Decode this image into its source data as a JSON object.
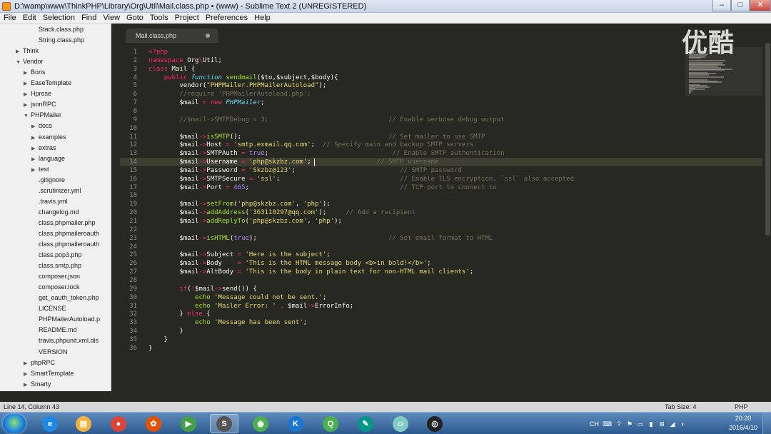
{
  "window": {
    "title": "D:\\wamp\\www\\ThinkPHP\\Library\\Org\\Util\\Mail.class.php • (www) - Sublime Text 2 (UNREGISTERED)",
    "minimize": "–",
    "maximize": "□",
    "close": "✕"
  },
  "menu": [
    "File",
    "Edit",
    "Selection",
    "Find",
    "View",
    "Goto",
    "Tools",
    "Project",
    "Preferences",
    "Help"
  ],
  "sidebar": {
    "items": [
      {
        "label": "Stack.class.php",
        "indent": 3,
        "type": "file"
      },
      {
        "label": "String.class.php",
        "indent": 3,
        "type": "file"
      },
      {
        "label": "Think",
        "indent": 1,
        "type": "folder"
      },
      {
        "label": "Vendor",
        "indent": 1,
        "type": "folder-open"
      },
      {
        "label": "Boris",
        "indent": 2,
        "type": "folder"
      },
      {
        "label": "EaseTemplate",
        "indent": 2,
        "type": "folder"
      },
      {
        "label": "Hprose",
        "indent": 2,
        "type": "folder"
      },
      {
        "label": "jsonRPC",
        "indent": 2,
        "type": "folder"
      },
      {
        "label": "PHPMailer",
        "indent": 2,
        "type": "folder-open"
      },
      {
        "label": "docs",
        "indent": 3,
        "type": "folder"
      },
      {
        "label": "examples",
        "indent": 3,
        "type": "folder"
      },
      {
        "label": "extras",
        "indent": 3,
        "type": "folder"
      },
      {
        "label": "language",
        "indent": 3,
        "type": "folder"
      },
      {
        "label": "test",
        "indent": 3,
        "type": "folder"
      },
      {
        "label": ".gitignore",
        "indent": 3,
        "type": "file"
      },
      {
        "label": ".scrutinizer.yml",
        "indent": 3,
        "type": "file"
      },
      {
        "label": ".travis.yml",
        "indent": 3,
        "type": "file"
      },
      {
        "label": "changelog.md",
        "indent": 3,
        "type": "file"
      },
      {
        "label": "class.phpmailer.php",
        "indent": 3,
        "type": "file"
      },
      {
        "label": "class.phpmaileroauth",
        "indent": 3,
        "type": "file"
      },
      {
        "label": "class.phpmaileroauth",
        "indent": 3,
        "type": "file"
      },
      {
        "label": "class.pop3.php",
        "indent": 3,
        "type": "file"
      },
      {
        "label": "class.smtp.php",
        "indent": 3,
        "type": "file"
      },
      {
        "label": "composer.json",
        "indent": 3,
        "type": "file"
      },
      {
        "label": "composer.lock",
        "indent": 3,
        "type": "file"
      },
      {
        "label": "get_oauth_token.php",
        "indent": 3,
        "type": "file"
      },
      {
        "label": "LICENSE",
        "indent": 3,
        "type": "file"
      },
      {
        "label": "PHPMailerAutoload.p",
        "indent": 3,
        "type": "file"
      },
      {
        "label": "README.md",
        "indent": 3,
        "type": "file"
      },
      {
        "label": "travis.phpunit.xml.dis",
        "indent": 3,
        "type": "file"
      },
      {
        "label": "VERSION",
        "indent": 3,
        "type": "file"
      },
      {
        "label": "phpRPC",
        "indent": 2,
        "type": "folder"
      },
      {
        "label": "SmartTemplate",
        "indent": 2,
        "type": "folder"
      },
      {
        "label": "Smarty",
        "indent": 2,
        "type": "folder"
      }
    ]
  },
  "tab": {
    "label": "Mail.class.php"
  },
  "code": [
    [
      [
        "k",
        "<?php"
      ]
    ],
    [
      [
        "k",
        "namespace "
      ],
      [
        "v",
        "Org"
      ],
      [
        "k",
        "\\"
      ],
      [
        "v",
        "Util;"
      ]
    ],
    [
      [
        "k",
        "class "
      ],
      [
        "v",
        "Mail {"
      ]
    ],
    [
      [
        "v",
        "    "
      ],
      [
        "k",
        "public "
      ],
      [
        "t",
        "function "
      ],
      [
        "f",
        "sendmail"
      ],
      [
        "v",
        "($to,$subject,$body){"
      ]
    ],
    [
      [
        "v",
        "        vendor("
      ],
      [
        "s",
        "\"PHPMailer.PHPMailerAutoload\""
      ],
      [
        "v",
        ");"
      ]
    ],
    [
      [
        "c",
        "        //require 'PHPMailerAutoload.php';"
      ]
    ],
    [
      [
        "v",
        "        $mail "
      ],
      [
        "k",
        "= new "
      ],
      [
        "cls",
        "PHPMailer"
      ],
      [
        "v",
        ";"
      ]
    ],
    [],
    [
      [
        "c",
        "        //$mail->SMTPDebug = 3;                               // Enable verbose debug output"
      ]
    ],
    [],
    [
      [
        "v",
        "        $mail"
      ],
      [
        "k",
        "->"
      ],
      [
        "f",
        "isSMTP"
      ],
      [
        "v",
        "();                                      "
      ],
      [
        "c",
        "// Set mailer to use SMTP"
      ]
    ],
    [
      [
        "v",
        "        $mail"
      ],
      [
        "k",
        "->"
      ],
      [
        "v",
        "Host "
      ],
      [
        "k",
        "= "
      ],
      [
        "s",
        "'smtp.exmail.qq.com'"
      ],
      [
        "v",
        ";  "
      ],
      [
        "c",
        "// Specify main and backup SMTP servers"
      ]
    ],
    [
      [
        "v",
        "        $mail"
      ],
      [
        "k",
        "->"
      ],
      [
        "v",
        "SMTPAuth "
      ],
      [
        "k",
        "= "
      ],
      [
        "n",
        "true"
      ],
      [
        "v",
        ";                                "
      ],
      [
        "c",
        "// Enable SMTP authentication"
      ]
    ],
    [
      [
        "v",
        "        $mail"
      ],
      [
        "k",
        "->"
      ],
      [
        "v",
        "Username "
      ],
      [
        "k",
        "= "
      ],
      [
        "s",
        "'php@skzbz.com'"
      ],
      [
        "v",
        ";                 "
      ],
      [
        "c",
        "// SMTP username"
      ]
    ],
    [
      [
        "v",
        "        $mail"
      ],
      [
        "k",
        "->"
      ],
      [
        "v",
        "Password "
      ],
      [
        "k",
        "= "
      ],
      [
        "s",
        "'Skzbz@123'"
      ],
      [
        "v",
        ";                           "
      ],
      [
        "c",
        "// SMTP password"
      ]
    ],
    [
      [
        "v",
        "        $mail"
      ],
      [
        "k",
        "->"
      ],
      [
        "v",
        "SMTPSecure "
      ],
      [
        "k",
        "= "
      ],
      [
        "s",
        "'ssl'"
      ],
      [
        "v",
        ";                               "
      ],
      [
        "c",
        "// Enable TLS encryption, `ssl` also accepted"
      ]
    ],
    [
      [
        "v",
        "        $mail"
      ],
      [
        "k",
        "->"
      ],
      [
        "v",
        "Port "
      ],
      [
        "k",
        "= "
      ],
      [
        "n",
        "465"
      ],
      [
        "v",
        ";                                       "
      ],
      [
        "c",
        "// TCP port to connect to"
      ]
    ],
    [],
    [
      [
        "v",
        "        $mail"
      ],
      [
        "k",
        "->"
      ],
      [
        "f",
        "setFrom"
      ],
      [
        "v",
        "("
      ],
      [
        "s",
        "'php@skzbz.com'"
      ],
      [
        "v",
        ", "
      ],
      [
        "s",
        "'php'"
      ],
      [
        "v",
        ");"
      ]
    ],
    [
      [
        "v",
        "        $mail"
      ],
      [
        "k",
        "->"
      ],
      [
        "f",
        "addAddress"
      ],
      [
        "v",
        "("
      ],
      [
        "s",
        "'363110297@qq.com'"
      ],
      [
        "v",
        ");     "
      ],
      [
        "c",
        "// Add a recipient"
      ]
    ],
    [
      [
        "v",
        "        $mail"
      ],
      [
        "k",
        "->"
      ],
      [
        "f",
        "addReplyTo"
      ],
      [
        "v",
        "("
      ],
      [
        "s",
        "'php@skzbz.com'"
      ],
      [
        "v",
        ", "
      ],
      [
        "s",
        "'php'"
      ],
      [
        "v",
        ");"
      ]
    ],
    [],
    [
      [
        "v",
        "        $mail"
      ],
      [
        "k",
        "->"
      ],
      [
        "f",
        "isHTML"
      ],
      [
        "v",
        "("
      ],
      [
        "n",
        "true"
      ],
      [
        "v",
        ");                                  "
      ],
      [
        "c",
        "// Set email format to HTML"
      ]
    ],
    [],
    [
      [
        "v",
        "        $mail"
      ],
      [
        "k",
        "->"
      ],
      [
        "v",
        "Subject "
      ],
      [
        "k",
        "= "
      ],
      [
        "s",
        "'Here is the subject'"
      ],
      [
        "v",
        ";"
      ]
    ],
    [
      [
        "v",
        "        $mail"
      ],
      [
        "k",
        "->"
      ],
      [
        "v",
        "Body    "
      ],
      [
        "k",
        "= "
      ],
      [
        "s",
        "'This is the HTML message body <b>in bold!</b>'"
      ],
      [
        "v",
        ";"
      ]
    ],
    [
      [
        "v",
        "        $mail"
      ],
      [
        "k",
        "->"
      ],
      [
        "v",
        "AltBody "
      ],
      [
        "k",
        "= "
      ],
      [
        "s",
        "'This is the body in plain text for non-HTML mail clients'"
      ],
      [
        "v",
        ";"
      ]
    ],
    [],
    [
      [
        "v",
        "        "
      ],
      [
        "k",
        "if"
      ],
      [
        "v",
        "("
      ],
      [
        "k",
        "!"
      ],
      [
        "v",
        "$mail"
      ],
      [
        "k",
        "->"
      ],
      [
        "v",
        "send()) {"
      ]
    ],
    [
      [
        "v",
        "            "
      ],
      [
        "f",
        "echo "
      ],
      [
        "s",
        "'Message could not be sent.'"
      ],
      [
        "v",
        ";"
      ]
    ],
    [
      [
        "v",
        "            "
      ],
      [
        "f",
        "echo "
      ],
      [
        "s",
        "'Mailer Error: '"
      ],
      [
        "v",
        " "
      ],
      [
        "k",
        "."
      ],
      [
        "v",
        " $mail"
      ],
      [
        "k",
        "->"
      ],
      [
        "v",
        "ErrorInfo;"
      ]
    ],
    [
      [
        "v",
        "        } "
      ],
      [
        "k",
        "else "
      ],
      [
        "v",
        "{"
      ]
    ],
    [
      [
        "v",
        "            "
      ],
      [
        "f",
        "echo "
      ],
      [
        "s",
        "'Message has been sent'"
      ],
      [
        "v",
        ";"
      ]
    ],
    [
      [
        "v",
        "        }"
      ]
    ],
    [
      [
        "v",
        "    }"
      ]
    ],
    [
      [
        "v",
        "}"
      ]
    ]
  ],
  "watermark": "优酷",
  "status": {
    "position": "Line 14, Column 43",
    "tabsize": "Tab Size: 4",
    "syntax": "PHP"
  },
  "taskbar": {
    "apps": [
      {
        "name": "ie-icon",
        "glyph": "e",
        "color": "#1e88e5"
      },
      {
        "name": "explorer-icon",
        "glyph": "▤",
        "color": "#f2b33d"
      },
      {
        "name": "chrome-icon",
        "glyph": "●",
        "color": "#db4437"
      },
      {
        "name": "app-icon",
        "glyph": "✿",
        "color": "#e65100"
      },
      {
        "name": "media-player-icon",
        "glyph": "▶",
        "color": "#43a047"
      },
      {
        "name": "sublime-icon",
        "glyph": "S",
        "color": "#555555"
      },
      {
        "name": "wechat-icon",
        "glyph": "◉",
        "color": "#4caf50"
      },
      {
        "name": "kugou-icon",
        "glyph": "K",
        "color": "#1976d2"
      },
      {
        "name": "iqiyi-icon",
        "glyph": "Q",
        "color": "#4caf50"
      },
      {
        "name": "app2-icon",
        "glyph": "✎",
        "color": "#009688"
      },
      {
        "name": "notes-icon",
        "glyph": "▱",
        "color": "#80cbc4"
      },
      {
        "name": "obs-icon",
        "glyph": "◎",
        "color": "#222222"
      }
    ],
    "tray": [
      "CH",
      "⌨",
      "?",
      "⚑",
      "▭",
      "▮",
      "⊞",
      "◢",
      "◐"
    ],
    "clock": {
      "time": "20:20",
      "date": "2016/4/10"
    }
  }
}
